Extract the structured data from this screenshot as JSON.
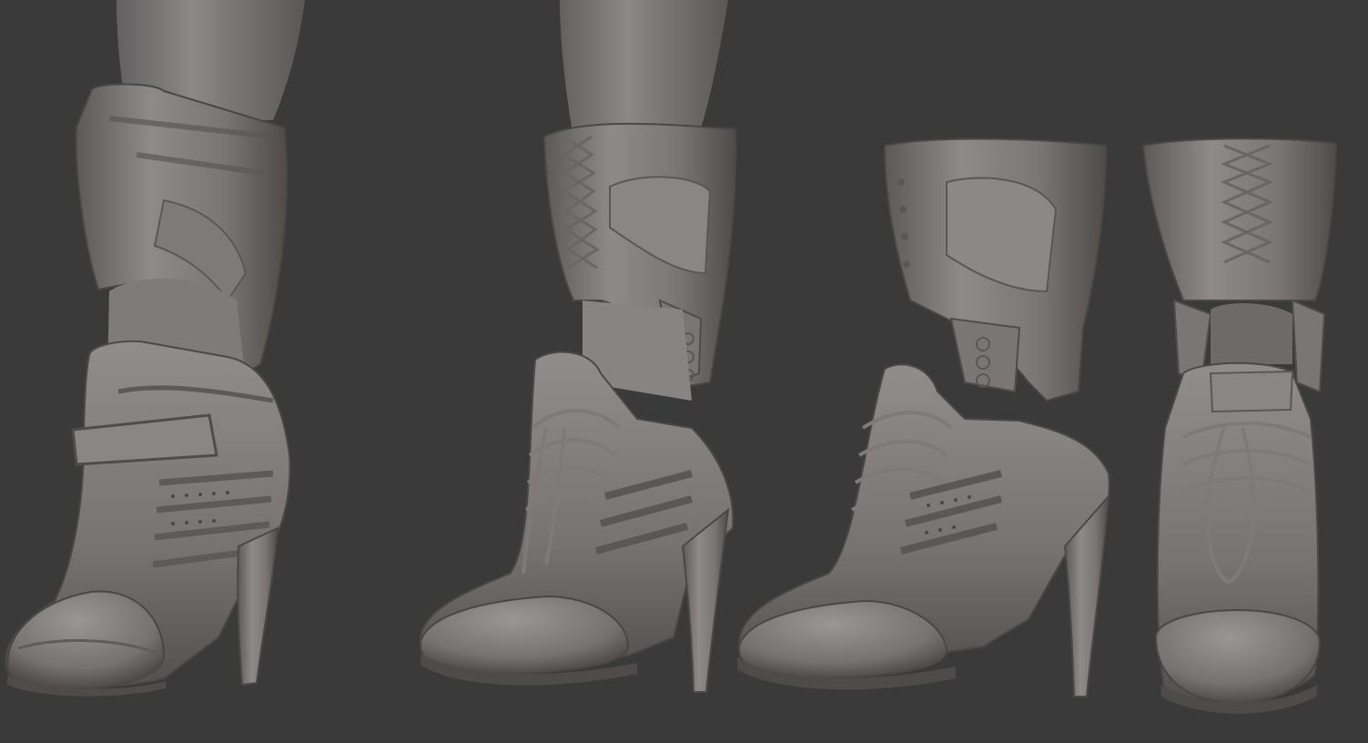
{
  "scene": {
    "subject": "boot-sculpt-turnaround",
    "views": [
      {
        "id": "boot-view-1",
        "angle": "front-three-quarter"
      },
      {
        "id": "boot-view-2",
        "angle": "side"
      },
      {
        "id": "boot-view-3",
        "angle": "side-separated"
      },
      {
        "id": "boot-view-4",
        "angle": "front"
      }
    ],
    "colors": {
      "background": "#3a3a3a",
      "clay_light": "#8e8a89",
      "clay_mid": "#736f6e",
      "clay_dark": "#4f4b4a",
      "clay_shadow": "#3f3c3b"
    }
  }
}
